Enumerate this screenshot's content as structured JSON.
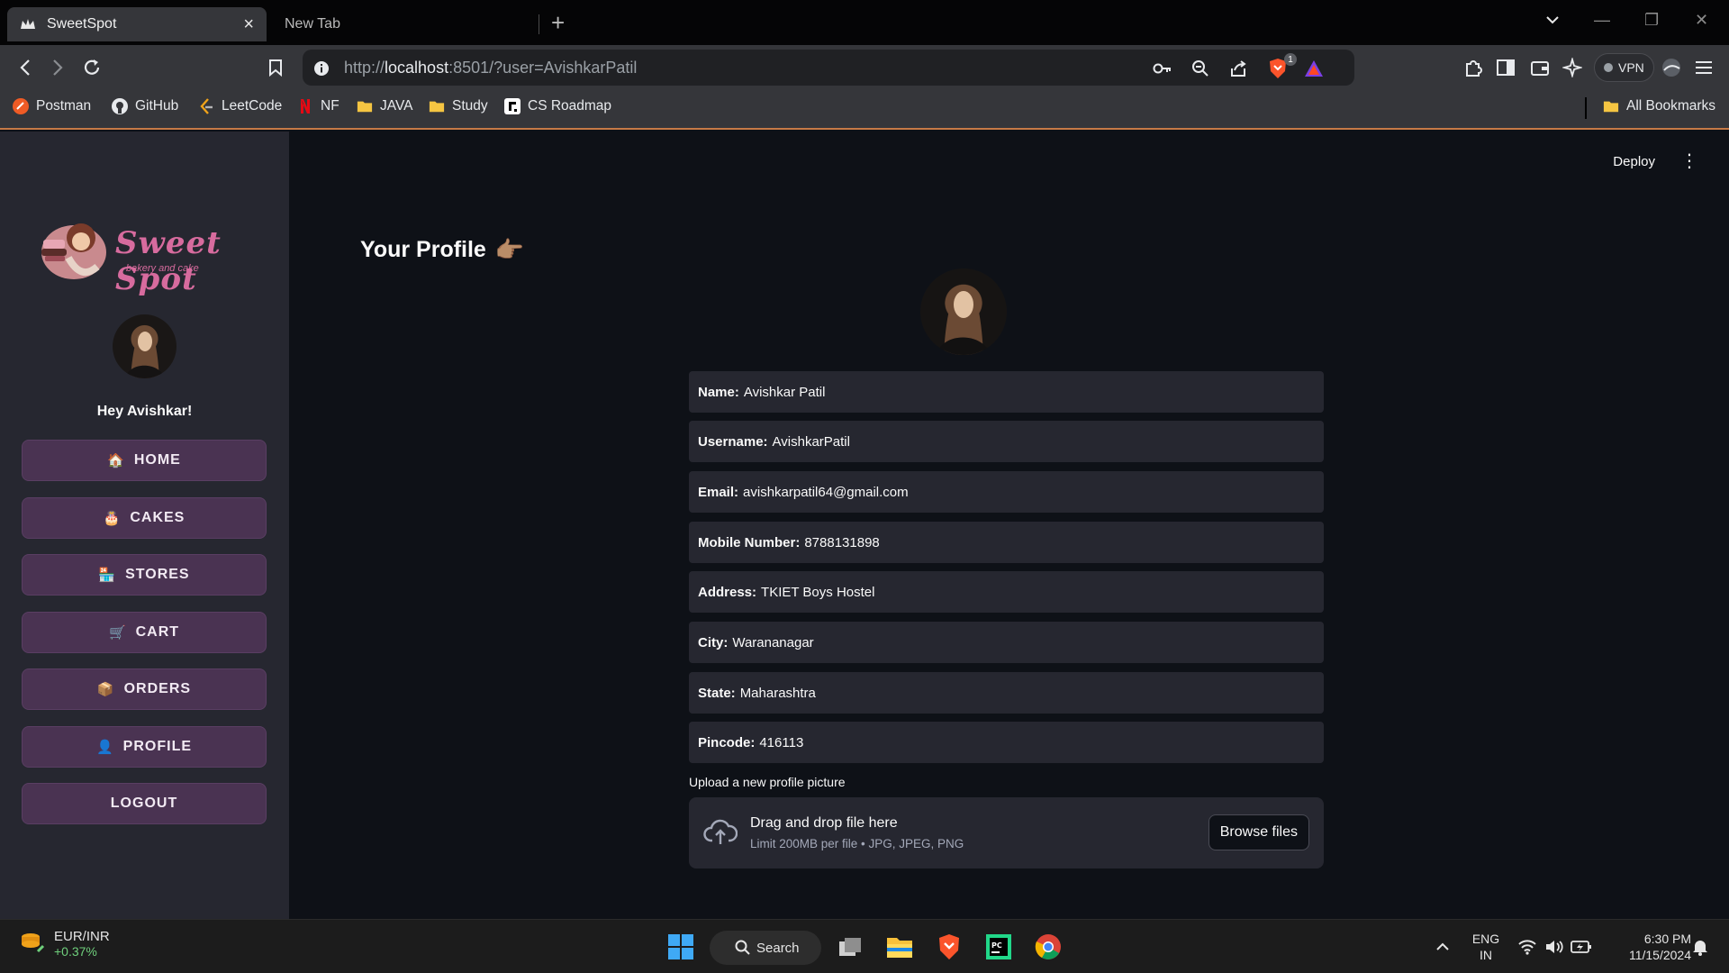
{
  "browser": {
    "active_tab": "SweetSpot",
    "inactive_tab": "New Tab",
    "url_prefix": "http://",
    "url_host": "localhost",
    "url_rest": ":8501/?user=AvishkarPatil",
    "vpn_label": "VPN",
    "shield_badge": "1",
    "bookmarks": [
      "Postman",
      "GitHub",
      "LeetCode",
      "NF",
      "JAVA",
      "Study",
      "CS Roadmap"
    ],
    "all_bookmarks": "All Bookmarks"
  },
  "app": {
    "brand": "Sweet Spot",
    "brand_sub": "bakery and cake",
    "greeting": "Hey Avishkar!",
    "deploy_label": "Deploy",
    "nav": [
      {
        "icon": "🏠",
        "label": "HOME"
      },
      {
        "icon": "🎂",
        "label": "CAKES"
      },
      {
        "icon": "🏪",
        "label": "STORES"
      },
      {
        "icon": "🛒",
        "label": "CART"
      },
      {
        "icon": "📦",
        "label": "ORDERS"
      },
      {
        "icon": "👤",
        "label": "PROFILE"
      },
      {
        "icon": "",
        "label": "LOGOUT"
      }
    ]
  },
  "profile": {
    "title": "Your Profile",
    "title_icon": "👉🏽",
    "fields": [
      {
        "label": "Name:",
        "value": "Avishkar Patil"
      },
      {
        "label": "Username:",
        "value": "AvishkarPatil"
      },
      {
        "label": "Email:",
        "value": "avishkarpatil64@gmail.com"
      },
      {
        "label": "Mobile Number:",
        "value": "8788131898"
      },
      {
        "label": "Address:",
        "value": "TKIET Boys Hostel"
      },
      {
        "label": "City:",
        "value": "Warananagar"
      },
      {
        "label": "State:",
        "value": "Maharashtra"
      },
      {
        "label": "Pincode:",
        "value": "416113"
      }
    ],
    "upload_label": "Upload a new profile picture",
    "dropzone_title": "Drag and drop file here",
    "dropzone_sub": "Limit 200MB per file • JPG, JPEG, PNG",
    "browse_label": "Browse files"
  },
  "taskbar": {
    "ticker": "EUR/INR",
    "ticker_change": "+0.37%",
    "search_label": "Search",
    "lang_top": "ENG",
    "lang_bottom": "IN",
    "time": "6:30 PM",
    "date": "11/15/2024"
  }
}
